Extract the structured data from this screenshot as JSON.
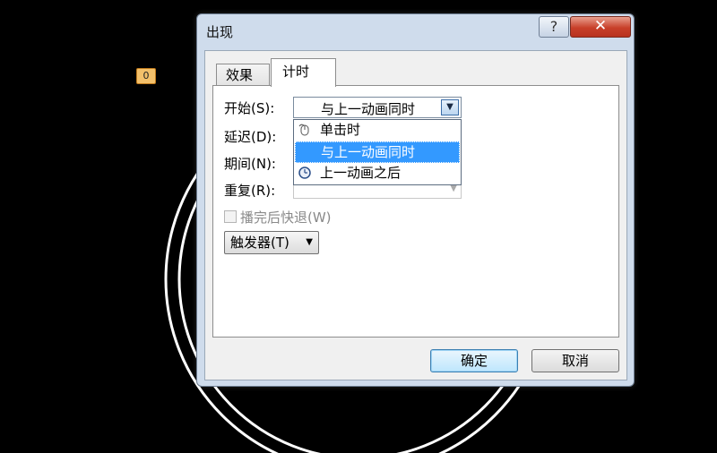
{
  "slide": {
    "animation_tag": "0"
  },
  "dialog": {
    "title": "出现",
    "help_label": "?",
    "close_label": "✕",
    "tabs": [
      {
        "label": "效果",
        "selected": false
      },
      {
        "label": "计时",
        "selected": true
      }
    ],
    "fields": {
      "start_label": "开始(S):",
      "delay_label": "延迟(D):",
      "period_label": "期间(N):",
      "repeat_label": "重复(R):"
    },
    "start_combo": {
      "value": "与上一动画同时",
      "options": [
        {
          "label": "单击时",
          "icon": "mouse-icon",
          "highlighted": false
        },
        {
          "label": "与上一动画同时",
          "icon": "",
          "highlighted": true
        },
        {
          "label": "上一动画之后",
          "icon": "clock-icon",
          "highlighted": false
        }
      ]
    },
    "rewind_checkbox": {
      "label": "播完后快退(W)",
      "checked": false,
      "disabled": true
    },
    "trigger_button": "触发器(T)",
    "ok_button": "确定",
    "cancel_button": "取消"
  },
  "colors": {
    "highlight": "#3399ff",
    "close_button": "#c8402a",
    "dialog_frame": "#cfdcec"
  }
}
